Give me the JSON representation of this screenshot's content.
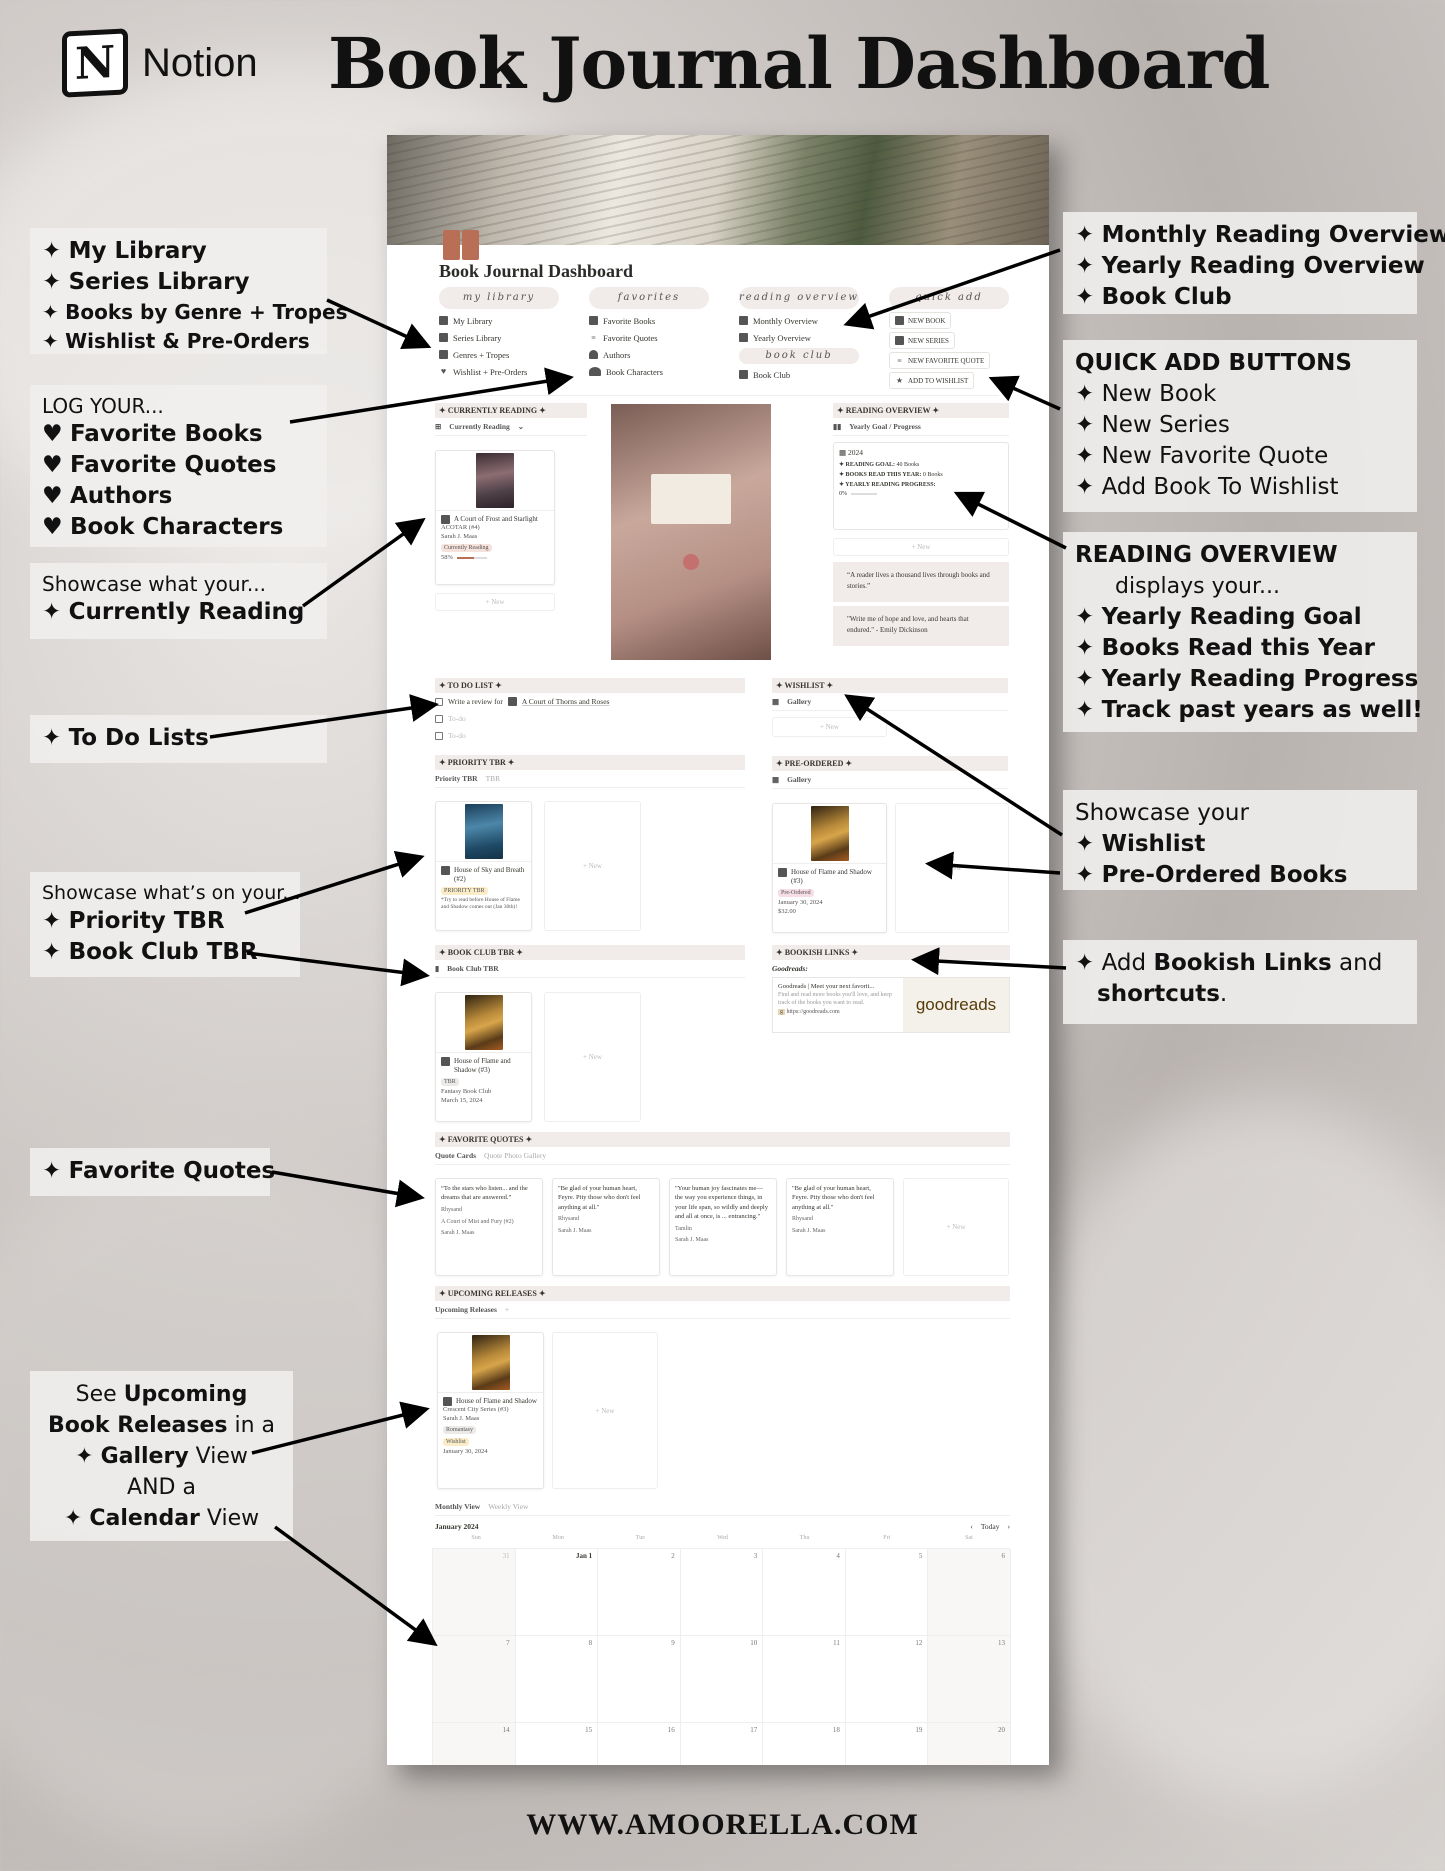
{
  "header": {
    "logo_letter": "N",
    "logo_text": "Notion",
    "title": "Book Journal Dashboard"
  },
  "footer": {
    "url": "WWW.AMOORELLA.COM"
  },
  "notion_page": {
    "title": "Book Journal Dashboard",
    "nav_groups": [
      {
        "pill": "my library",
        "links": [
          {
            "icon": "books-icon",
            "label": "My Library"
          },
          {
            "icon": "series-icon",
            "label": "Series Library"
          },
          {
            "icon": "list-icon",
            "label": "Genres + Tropes"
          },
          {
            "icon": "heart-icon",
            "label": "Wishlist + Pre-Orders"
          }
        ]
      },
      {
        "pill": "favorites",
        "links": [
          {
            "icon": "books-icon",
            "label": "Favorite Books"
          },
          {
            "icon": "quote-icon",
            "label": "Favorite Quotes"
          },
          {
            "icon": "person-icon",
            "label": "Authors"
          },
          {
            "icon": "people-icon",
            "label": "Book Characters"
          }
        ]
      },
      {
        "pill": "reading overview",
        "links": [
          {
            "icon": "calendar-icon",
            "label": "Monthly Overview"
          },
          {
            "icon": "calendar-icon",
            "label": "Yearly Overview"
          }
        ]
      },
      {
        "pill": "book club",
        "links": [
          {
            "icon": "books-icon",
            "label": "Book Club"
          }
        ]
      }
    ],
    "quick_add": {
      "pill": "quick add",
      "buttons": [
        {
          "icon": "book-icon",
          "label": "NEW BOOK"
        },
        {
          "icon": "series-icon",
          "label": "NEW SERIES"
        },
        {
          "icon": "quote-icon",
          "label": "NEW FAVORITE QUOTE"
        },
        {
          "icon": "star-icon",
          "label": "ADD TO WISHLIST"
        }
      ]
    },
    "currently_reading": {
      "heading": "✦ CURRENTLY READING ✦",
      "view": "Currently Reading",
      "card": {
        "title": "A Court of Frost and Starlight",
        "series": "ACOTAR (#4)",
        "author": "Sarah J. Maas",
        "status": "Currently Reading",
        "progress_label": "58%",
        "progress": 0.58
      },
      "new_label": "+ New"
    },
    "reading_overview": {
      "heading": "✦ READING OVERVIEW ✦",
      "view": "Yearly Goal / Progress",
      "year": "2024",
      "goal_label": "✦ READING GOAL:",
      "goal_value": "40 Books",
      "read_label": "✦ BOOKS READ THIS YEAR:",
      "read_value": "0 Books",
      "progress_label": "✦ YEARLY READING PROGRESS:",
      "progress_text": "0%",
      "progress": 0,
      "new_label": "+ New",
      "quotes": [
        "“A reader lives a thousand lives through books and stories.”",
        "\"Write me of hope and love, and hearts that endured.\" - Emily Dickinson"
      ]
    },
    "todo": {
      "heading": "✦ TO DO LIST ✦",
      "items": [
        {
          "text": "Write a review for",
          "link": "A Court of Thorns and Roses",
          "checked": false
        },
        {
          "text": "To-do",
          "placeholder": true,
          "checked": false
        },
        {
          "text": "To-do",
          "placeholder": true,
          "checked": false
        }
      ]
    },
    "wishlist": {
      "heading": "✦ WISHLIST ✦",
      "view": "Gallery",
      "new_label": "+ New"
    },
    "priority_tbr": {
      "heading": "✦ PRIORITY TBR ✦",
      "tabs": [
        "Priority TBR",
        "TBR"
      ],
      "card": {
        "title": "House of Sky and Breath (#2)",
        "tag": "PRIORITY TBR",
        "note": "*Try to read before House of Flame and Shadow comes out (Jan 30th)!"
      },
      "new_label": "+ New"
    },
    "pre_ordered": {
      "heading": "✦ PRE-ORDERED ✦",
      "view": "Gallery",
      "card": {
        "title": "House of Flame and Shadow (#3)",
        "tag": "Pre-Ordered",
        "date": "January 30, 2024",
        "price": "$32.00"
      },
      "new_label": "+ New"
    },
    "book_club_tbr": {
      "heading": "✦ BOOK CLUB TBR ✦",
      "view": "Book Club TBR",
      "card": {
        "title": "House of Flame and Shadow (#3)",
        "tag": "TBR",
        "club": "Fantasy Book Club",
        "date": "March 15, 2024"
      },
      "new_label": "+ New"
    },
    "bookish_links": {
      "heading": "✦ BOOKISH LINKS ✦",
      "label": "Goodreads:",
      "bookmark": {
        "title": "Goodreads | Meet your next favorit...",
        "desc": "Find and read more books you'll love, and keep track of the books you want to read.",
        "url": "https://goodreads.com",
        "logo_a": "good",
        "logo_b": "reads"
      }
    },
    "favorite_quotes": {
      "heading": "✦ FAVORITE QUOTES ✦",
      "tabs": [
        "Quote Cards",
        "Quote Photo Gallery"
      ],
      "cards": [
        {
          "quote": "“To the stars who listen... and the dreams that are answered.”",
          "character": "Rhysand",
          "book": "A Court of Mist and Fury (#2)",
          "author": "Sarah J. Maas"
        },
        {
          "quote": "\"Be glad of your human heart, Feyre. Pity those who don't feel anything at all.\"",
          "character": "Rhysand",
          "author": "Sarah J. Maas"
        },
        {
          "quote": "\"Your human joy fascinates me— the way you experience things, in your life span, so wildly and deeply and all at once, is ... entrancing.\"",
          "character": "Tamlin",
          "author": "Sarah J. Maas"
        },
        {
          "quote": "\"Be glad of your human heart, Feyre. Pity those who don't feel anything at all.\"",
          "character": "Rhysand",
          "author": "Sarah J. Maas"
        }
      ],
      "new_label": "+ New"
    },
    "upcoming": {
      "heading": "✦ UPCOMING RELEASES ✦",
      "tab": "Upcoming Releases",
      "add_tab": "+",
      "card": {
        "title": "House of Flame and Shadow",
        "series": "Crescent City Series (#3)",
        "author": "Sarah J. Maas",
        "genre": "Romantasy",
        "status": "Wishlist",
        "date": "January 30, 2024"
      },
      "new_label": "+ New"
    },
    "calendar": {
      "tabs": [
        "Monthly View",
        "Weekly View"
      ],
      "month": "January 2024",
      "today": "Today",
      "prev": "‹",
      "next": "›",
      "weekdays": [
        "Sun",
        "Mon",
        "Tue",
        "Wed",
        "Thu",
        "Fri",
        "Sat"
      ],
      "weeks": [
        [
          "31",
          "Jan 1",
          "2",
          "3",
          "4",
          "5",
          "6"
        ],
        [
          "7",
          "8",
          "9",
          "10",
          "11",
          "12",
          "13"
        ],
        [
          "14",
          "15",
          "16",
          "17",
          "18",
          "19",
          "20"
        ]
      ]
    }
  },
  "callouts": {
    "library": [
      "My Library",
      "Series Library",
      "Books by Genre + Tropes",
      "Wishlist & Pre-Orders"
    ],
    "log": {
      "intro": "LOG YOUR...",
      "items": [
        "Favorite Books",
        "Favorite Quotes",
        "Authors",
        "Book Characters"
      ]
    },
    "currently": {
      "intro": "Showcase what your...",
      "item": "Currently Reading"
    },
    "todo": "To Do Lists",
    "tbr": {
      "intro": "Showcase what’s on your...",
      "items": [
        "Priority TBR",
        "Book Club TBR"
      ]
    },
    "quotes": "Favorite Quotes",
    "upcoming": {
      "l1a": "See ",
      "l1b": "Upcoming",
      "l2a": "Book Releases",
      "l2b": " in a",
      "l3a": "Gallery",
      "l3b": " View",
      "l4": "AND a",
      "l5a": "Calendar",
      "l5b": " View"
    },
    "overview": [
      "Monthly Reading Overview",
      "Yearly Reading Overview",
      "Book Club"
    ],
    "quick_add": {
      "title": "QUICK ADD BUTTONS",
      "items": [
        "New Book",
        "New Series",
        "New Favorite Quote",
        "Add Book To Wishlist"
      ]
    },
    "reading_overview": {
      "title": "READING OVERVIEW",
      "sub": "displays your...",
      "items": [
        "Yearly Reading Goal",
        "Books Read this Year",
        "Yearly Reading Progress",
        "Track past years as well!"
      ]
    },
    "wishlist": {
      "intro": "Showcase your",
      "items": [
        "Wishlist",
        "Pre-Ordered Books"
      ]
    },
    "links": {
      "a": "Add ",
      "b": "Bookish Links",
      "c": " and",
      "d": "shortcuts",
      "e": "."
    }
  },
  "colors": {
    "accent": "#b86f56",
    "pill_bg": "#f1ebea",
    "priority_tag": "#fbecc8",
    "preorder_tag": "#f6dde6"
  }
}
